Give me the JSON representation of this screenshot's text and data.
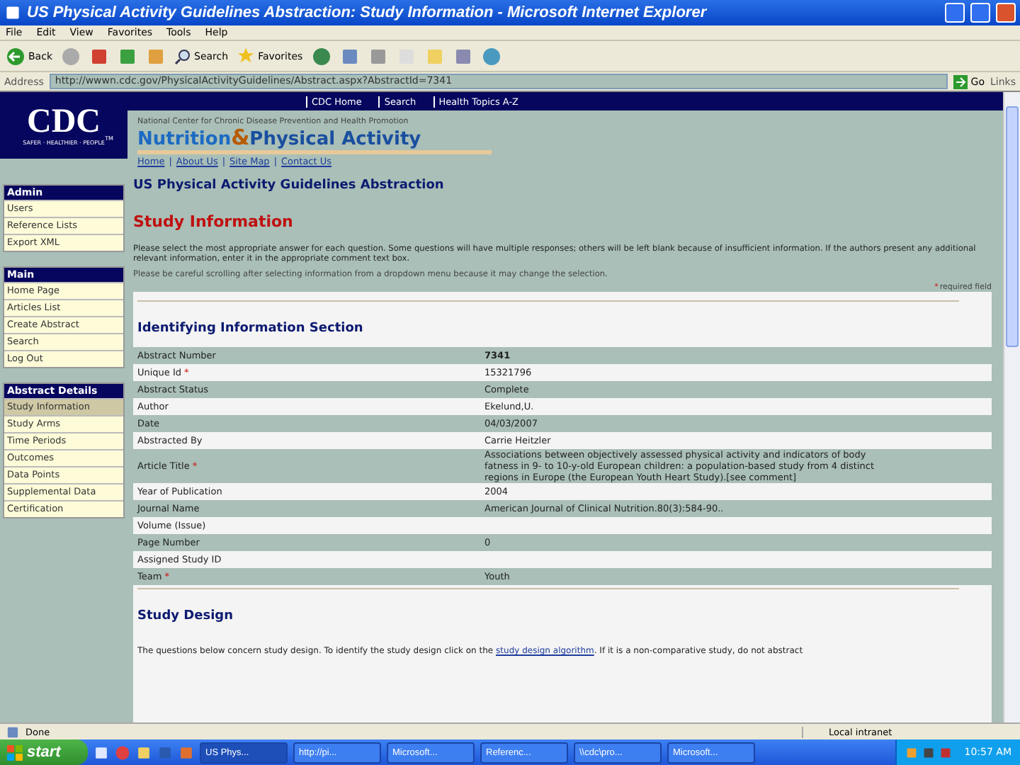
{
  "window": {
    "title": "US Physical Activity Guidelines Abstraction: Study Information - Microsoft Internet Explorer"
  },
  "menu": [
    "File",
    "Edit",
    "View",
    "Favorites",
    "Tools",
    "Help"
  ],
  "toolbar": {
    "back": "Back",
    "search": "Search",
    "favorites": "Favorites"
  },
  "address": {
    "label": "Address",
    "url": "http://wwwn.cdc.gov/PhysicalActivityGuidelines/Abstract.aspx?AbstractId=7341",
    "go": "Go",
    "links": "Links"
  },
  "site_header": {
    "logo": "CDC",
    "logo_tagline": "SAFER · HEALTHIER · PEOPLE",
    "logo_tm": "TM",
    "top_links": [
      "CDC Home",
      "Search",
      "Health Topics A-Z"
    ],
    "center": "National Center for Chronic Disease Prevention and Health Promotion",
    "brand_left": "Nutrition",
    "brand_amp": "&",
    "brand_right": "Physical Activity",
    "separator": "|",
    "links": [
      "Home",
      "About Us",
      "Site Map",
      "Contact Us"
    ]
  },
  "sidebar": [
    {
      "title": "Admin",
      "items": [
        {
          "label": "Users",
          "selected": false
        },
        {
          "label": "Reference Lists",
          "selected": false
        },
        {
          "label": "Export XML",
          "selected": false
        }
      ]
    },
    {
      "title": "Main",
      "items": [
        {
          "label": "Home Page",
          "selected": false
        },
        {
          "label": "Articles List",
          "selected": false
        },
        {
          "label": "Create Abstract",
          "selected": false
        },
        {
          "label": "Search",
          "selected": false
        },
        {
          "label": "Log Out",
          "selected": false
        }
      ]
    },
    {
      "title": "Abstract Details",
      "items": [
        {
          "label": "Study Information",
          "selected": true
        },
        {
          "label": "Study Arms",
          "selected": false
        },
        {
          "label": "Time Periods",
          "selected": false
        },
        {
          "label": "Outcomes",
          "selected": false
        },
        {
          "label": "Data Points",
          "selected": false
        },
        {
          "label": "Supplemental Data",
          "selected": false
        },
        {
          "label": "Certification",
          "selected": false
        }
      ]
    }
  ],
  "main": {
    "site_title": "US Physical Activity Guidelines Abstraction",
    "page_title": "Study Information",
    "instructions": [
      "Please select the most appropriate answer for each question. Some questions will have multiple responses; others will be left blank because of insufficient information. If the authors present any additional relevant information, enter it in the appropriate comment text box.",
      "Please be careful scrolling after selecting information from a dropdown menu because it may change the selection."
    ],
    "required_marker": "*",
    "required_note": "required field",
    "section": "Identifying Information Section",
    "rows": [
      {
        "label": "Abstract Number",
        "value": "7341",
        "bold": true
      },
      {
        "label": "Unique Id",
        "marker": "*",
        "value": "15321796"
      },
      {
        "label": "Abstract Status",
        "value": "Complete"
      },
      {
        "label": "Author",
        "value": "Ekelund,U."
      },
      {
        "label": "Date",
        "value": "04/03/2007"
      },
      {
        "label": "Abstracted By",
        "value": "Carrie Heitzler"
      },
      {
        "label": "Article Title",
        "marker": "*",
        "value": "Associations between objectively assessed physical activity and indicators of body fatness in 9- to 10-y-old European children: a population-based study from 4 distinct regions in Europe (the European Youth Heart Study).[see comment]"
      },
      {
        "label": "Year of Publication",
        "value": "2004"
      },
      {
        "label": "Journal Name",
        "value": "American Journal of Clinical Nutrition.80(3):584-90.."
      },
      {
        "label": "Volume (Issue)"
      },
      {
        "label": "Page Number",
        "value": "0"
      },
      {
        "label": "Assigned Study ID"
      },
      {
        "label": "Team",
        "marker": "*",
        "value": "Youth"
      }
    ],
    "section2": "Study Design",
    "design_text_before": "The questions below concern study design. To identify the study design click on the",
    "design_link": "study design algorithm",
    "design_text_after": ". If it is a non-comparative study, do not abstract"
  },
  "status_bar": {
    "text": "Done",
    "zone": "Local intranet"
  },
  "taskbar": {
    "start": "start",
    "tasks": [
      {
        "label": "US Phys...",
        "selected": true
      },
      {
        "label": "http://pi...",
        "selected": false
      },
      {
        "label": "Microsoft...",
        "selected": false
      },
      {
        "label": "Referenc...",
        "selected": false
      },
      {
        "label": "\\\\cdc\\pro...",
        "selected": false
      },
      {
        "label": "Microsoft...",
        "selected": false
      }
    ],
    "clock": "10:57 AM"
  }
}
